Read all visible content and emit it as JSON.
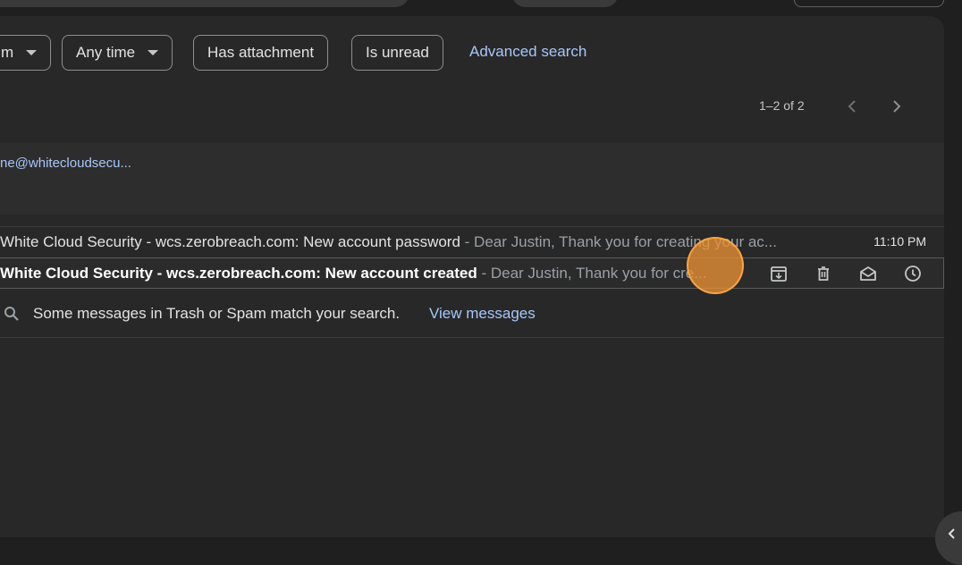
{
  "filters": {
    "chip_from": "m",
    "chip_time": "Any time",
    "chip_attachment": "Has attachment",
    "chip_unread": "Is unread",
    "advanced_search": "Advanced search"
  },
  "pagination": {
    "range_text": "1–2 of 2"
  },
  "section": {
    "email_truncated": "ne@whitecloudsecu..."
  },
  "messages": [
    {
      "subject": "White Cloud Security - wcs.zerobreach.com: New account password",
      "snippet": " - Dear Justin, Thank you for creating your ac...",
      "time": "11:10 PM",
      "unread": false
    },
    {
      "subject": "White Cloud Security - wcs.zerobreach.com: New account created",
      "snippet": " - Dear Justin, Thank you for cre...",
      "unread": true,
      "actions": [
        "archive-icon",
        "trash-icon",
        "mark-read-icon",
        "snooze-icon"
      ]
    }
  ],
  "notice": {
    "text": "Some messages in Trash or Spam match your search.",
    "link": "View messages"
  },
  "colors": {
    "background": "#1f1f1f",
    "panel": "#282828",
    "link": "#a8c7fa",
    "cursor_highlight": "#e89134"
  }
}
